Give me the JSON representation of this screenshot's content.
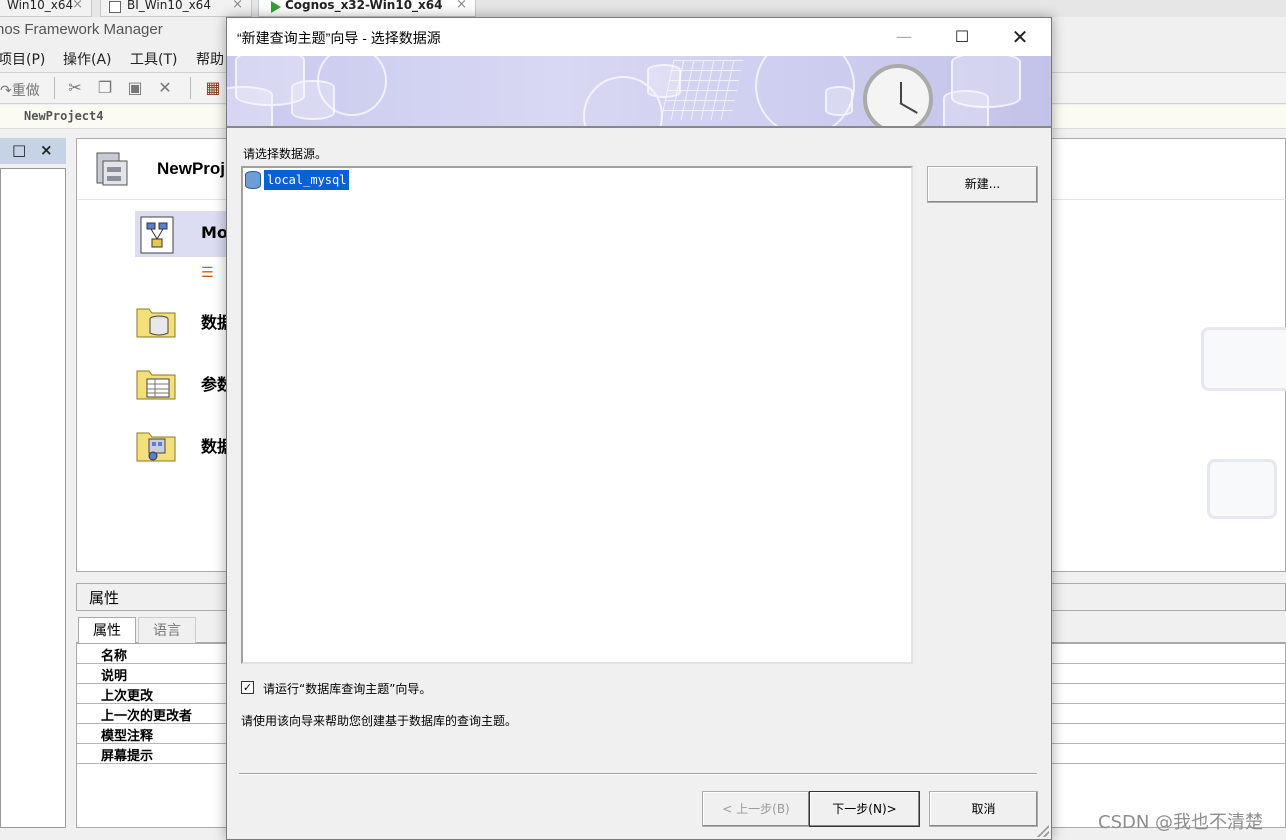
{
  "vm_tabs": [
    {
      "label": "Win10_x64",
      "active": false
    },
    {
      "label": "BI_Win10_x64",
      "active": false
    },
    {
      "label": "Cognos_x32-Win10_x64",
      "active": true
    }
  ],
  "app": {
    "title": "nos Framework Manager",
    "menus": [
      "项目(P)",
      "操作(A)",
      "工具(T)",
      "帮助"
    ],
    "toolbar": {
      "redo_label": "重做"
    },
    "breadcrumb": "NewProject4"
  },
  "project": {
    "title": "NewProj",
    "rows": [
      {
        "label": "Mo",
        "icon": "model-icon"
      },
      {
        "label": "数据",
        "icon": "datasource-folder-icon"
      },
      {
        "label": "参数",
        "icon": "parameter-folder-icon"
      },
      {
        "label": "数据",
        "icon": "package-folder-icon"
      }
    ]
  },
  "properties": {
    "header": "属性",
    "tabs": [
      "属性",
      "语言"
    ],
    "rows": [
      "名称",
      "说明",
      "上次更改",
      "上一次的更改者",
      "模型注释",
      "屏幕提示"
    ]
  },
  "dialog": {
    "title": "“新建查询主题”向导 - 选择数据源",
    "prompt": "请选择数据源。",
    "datasources": [
      {
        "name": "local_mysql",
        "selected": true
      }
    ],
    "new_button": "新建...",
    "checkbox_label": "请运行“数据库查询主题”向导。",
    "checkbox_checked": true,
    "help_text": "请使用该向导来帮助您创建基于数据库的查询主题。",
    "back_button": "< 上一步(B)",
    "next_button": "下一步(N)>",
    "cancel_button": "取消"
  },
  "watermark": "CSDN @我也不清楚",
  "colors": {
    "selection": "#0a60d6",
    "banner": "#c9c9ee",
    "selected_row": "#dcdcf2"
  }
}
